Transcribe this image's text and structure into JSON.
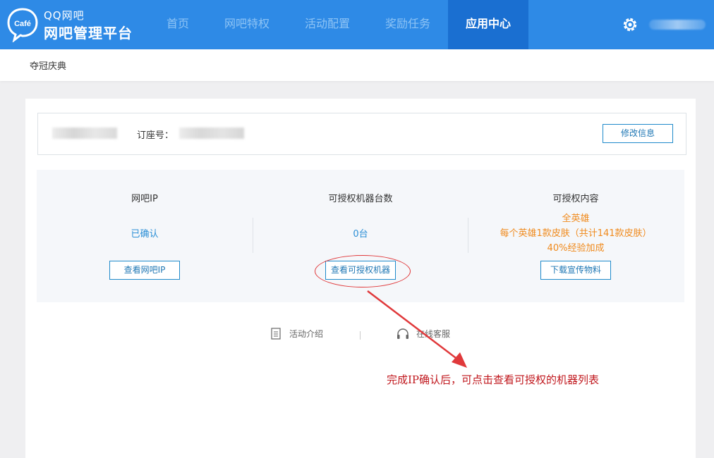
{
  "header": {
    "brand_small": "QQ网吧",
    "brand_big": "网吧管理平台",
    "logo_text": "Café",
    "nav": [
      {
        "label": "首页"
      },
      {
        "label": "网吧特权"
      },
      {
        "label": "活动配置"
      },
      {
        "label": "奖励任务"
      },
      {
        "label": "应用中心",
        "active": true
      }
    ],
    "settings_icon": "gear-icon"
  },
  "subbar": {
    "title": "夺冠庆典"
  },
  "info": {
    "order_label": "订座号：",
    "edit_button": "修改信息"
  },
  "stats": {
    "col1": {
      "title": "网吧IP",
      "value": "已确认",
      "button": "查看网吧IP"
    },
    "col2": {
      "title": "可授权机器台数",
      "value": "0台",
      "button": "查看可授权机器"
    },
    "col3": {
      "title": "可授权内容",
      "lines": [
        "全英雄",
        "每个英雄1款皮肤（共计141款皮肤）",
        "40%经验加成"
      ],
      "button": "下载宣传物料"
    }
  },
  "links": {
    "activity": "活动介绍",
    "service": "在线客服"
  },
  "annotation": "完成IP确认后，可点击查看可授权的机器列表",
  "colors": {
    "header_bg": "#2e8ae6",
    "nav_active_bg": "#1a6fd1",
    "accent_blue": "#1f8acb",
    "content_orange": "#f08a1c",
    "annotation_red": "#c0171d"
  }
}
